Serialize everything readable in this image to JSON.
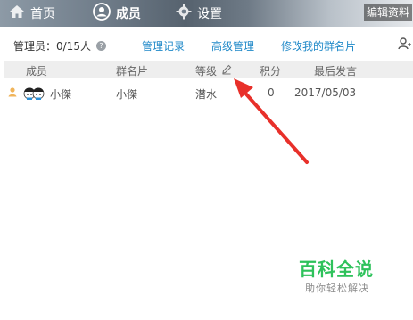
{
  "nav": {
    "home": "首页",
    "members": "成员",
    "settings": "设置",
    "edit_profile": "编辑资料"
  },
  "toolbar": {
    "admins": "管理员：0/15人",
    "manage_log": "管理记录",
    "advanced_manage": "高级管理",
    "edit_my_card": "修改我的群名片"
  },
  "table": {
    "headers": {
      "member": "成员",
      "card": "群名片",
      "level": "等级",
      "points": "积分",
      "last_post": "最后发言"
    },
    "rows": [
      {
        "name": "小傑",
        "card": "小傑",
        "level": "潜水",
        "points": "0",
        "last_post": "2017/05/03"
      }
    ]
  },
  "watermark": {
    "title": "百科全说",
    "subtitle": "助你轻松解决"
  },
  "colors": {
    "link": "#1e88c8",
    "arrow": "#e8302a",
    "watermark": "#2ec25b"
  }
}
